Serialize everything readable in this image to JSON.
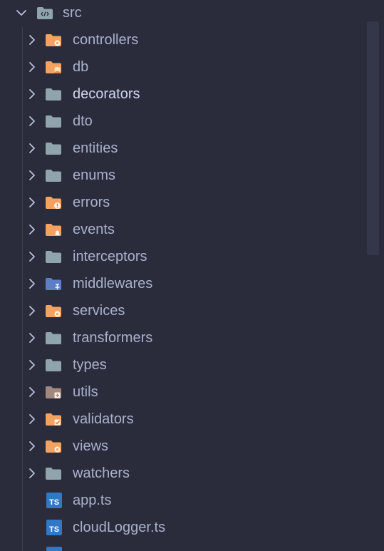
{
  "explorer": {
    "root": {
      "label": "src",
      "icon": "folder-src-open-icon"
    },
    "items": [
      {
        "label": "controllers",
        "kind": "folder",
        "icon": "folder-controllers-icon"
      },
      {
        "label": "db",
        "kind": "folder",
        "icon": "folder-database-icon"
      },
      {
        "label": "decorators",
        "kind": "folder",
        "icon": "folder-plain-icon"
      },
      {
        "label": "dto",
        "kind": "folder",
        "icon": "folder-plain-icon"
      },
      {
        "label": "entities",
        "kind": "folder",
        "icon": "folder-plain-icon"
      },
      {
        "label": "enums",
        "kind": "folder",
        "icon": "folder-plain-icon"
      },
      {
        "label": "errors",
        "kind": "folder",
        "icon": "folder-errors-icon"
      },
      {
        "label": "events",
        "kind": "folder",
        "icon": "folder-events-icon"
      },
      {
        "label": "interceptors",
        "kind": "folder",
        "icon": "folder-plain-icon"
      },
      {
        "label": "middlewares",
        "kind": "folder",
        "icon": "folder-middleware-icon"
      },
      {
        "label": "services",
        "kind": "folder",
        "icon": "folder-services-icon"
      },
      {
        "label": "transformers",
        "kind": "folder",
        "icon": "folder-plain-icon"
      },
      {
        "label": "types",
        "kind": "folder",
        "icon": "folder-plain-icon"
      },
      {
        "label": "utils",
        "kind": "folder",
        "icon": "folder-utils-icon"
      },
      {
        "label": "validators",
        "kind": "folder",
        "icon": "folder-validators-icon"
      },
      {
        "label": "views",
        "kind": "folder",
        "icon": "folder-views-icon"
      },
      {
        "label": "watchers",
        "kind": "folder",
        "icon": "folder-plain-icon"
      },
      {
        "label": "app.ts",
        "kind": "file",
        "icon": "typescript-file-icon"
      },
      {
        "label": "cloudLogger.ts",
        "kind": "file",
        "icon": "typescript-file-icon"
      },
      {
        "label": "",
        "kind": "file",
        "icon": "typescript-file-icon"
      }
    ],
    "highlighted": "decorators"
  },
  "colors": {
    "background": "#2a2c3b",
    "text": "#a9b1cc",
    "text_highlight": "#cfd6ee",
    "folder_plain": "#90a4ae",
    "folder_accent": "#f4a261",
    "typescript": "#3178c6"
  }
}
